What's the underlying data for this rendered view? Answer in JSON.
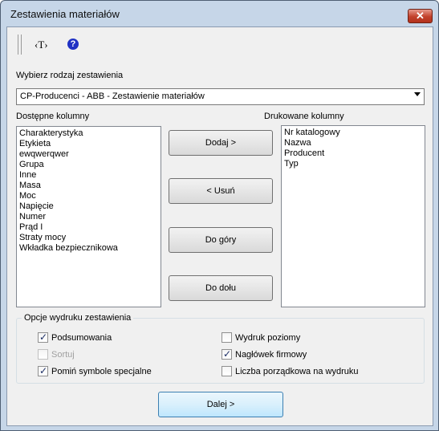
{
  "window": {
    "title": "Zestawienia materiałów",
    "close_glyph": "✕"
  },
  "toolbar": {
    "text_tool_glyph": "‹T›",
    "help_glyph": "?"
  },
  "report_type": {
    "label": "Wybierz rodzaj zestawienia",
    "selected": "CP-Producenci - ABB - Zestawienie materiałów"
  },
  "available": {
    "label": "Dostępne kolumny",
    "items": [
      "Charakterystyka",
      "Etykieta",
      "ewqwerqwer",
      "Grupa",
      "Inne",
      "Masa",
      "Moc",
      "Napięcie",
      "Numer",
      "Prąd I",
      "Straty mocy",
      "Wkładka bezpiecznikowa"
    ]
  },
  "printed": {
    "label": "Drukowane kolumny",
    "items": [
      "Nr katalogowy",
      "Nazwa",
      "Producent",
      "Typ"
    ]
  },
  "buttons": {
    "add": "Dodaj >",
    "remove": "< Usuń",
    "up": "Do góry",
    "down": "Do dołu",
    "next": "Dalej >"
  },
  "options": {
    "title": "Opcje wydruku zestawienia",
    "summary": {
      "label": "Podsumowania",
      "checked": true
    },
    "sort": {
      "label": "Sortuj",
      "checked": false,
      "disabled": true
    },
    "skip_symbols": {
      "label": "Pomiń symbole specjalne",
      "checked": true
    },
    "horizontal": {
      "label": "Wydruk poziomy",
      "checked": false
    },
    "company_header": {
      "label": "Nagłówek firmowy",
      "checked": true
    },
    "ordinal": {
      "label": "Liczba porządkowa na wydruku",
      "checked": false
    }
  },
  "colors": {
    "close_button": "#c2412b",
    "help_icon": "#1f31c4",
    "frame": "#c6d6e8"
  },
  "icons": {
    "text_tool": "text-tool-icon",
    "help": "help-icon",
    "close": "close-icon",
    "dropdown": "chevron-down-icon",
    "check": "checkmark-icon"
  }
}
